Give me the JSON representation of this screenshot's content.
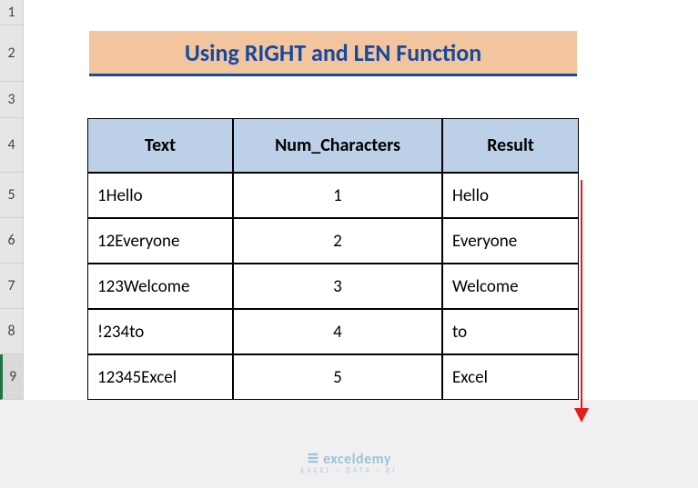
{
  "row_headers": [
    "1",
    "2",
    "3",
    "4",
    "5",
    "6",
    "7",
    "8",
    "9"
  ],
  "selected_row_index": 8,
  "title": "Using RIGHT and LEN Function",
  "table": {
    "headers": {
      "text": "Text",
      "num": "Num_Characters",
      "result": "Result"
    },
    "rows": [
      {
        "text": "1Hello",
        "num": "1",
        "result": "Hello"
      },
      {
        "text": "12Everyone",
        "num": "2",
        "result": "Everyone"
      },
      {
        "text": "123Welcome",
        "num": "3",
        "result": "Welcome"
      },
      {
        "text": "!234to",
        "num": "4",
        "result": "to"
      },
      {
        "text": "12345Excel",
        "num": "5",
        "result": "Excel"
      }
    ]
  },
  "watermark": {
    "brand": "exceldemy",
    "tagline": "EXCEL · DATA · BI"
  },
  "chart_data": {
    "type": "table",
    "title": "Using RIGHT and LEN Function",
    "columns": [
      "Text",
      "Num_Characters",
      "Result"
    ],
    "rows": [
      [
        "1Hello",
        1,
        "Hello"
      ],
      [
        "12Everyone",
        2,
        "Everyone"
      ],
      [
        "123Welcome",
        3,
        "Welcome"
      ],
      [
        "!234to",
        4,
        "to"
      ],
      [
        "12345Excel",
        5,
        "Excel"
      ]
    ]
  }
}
